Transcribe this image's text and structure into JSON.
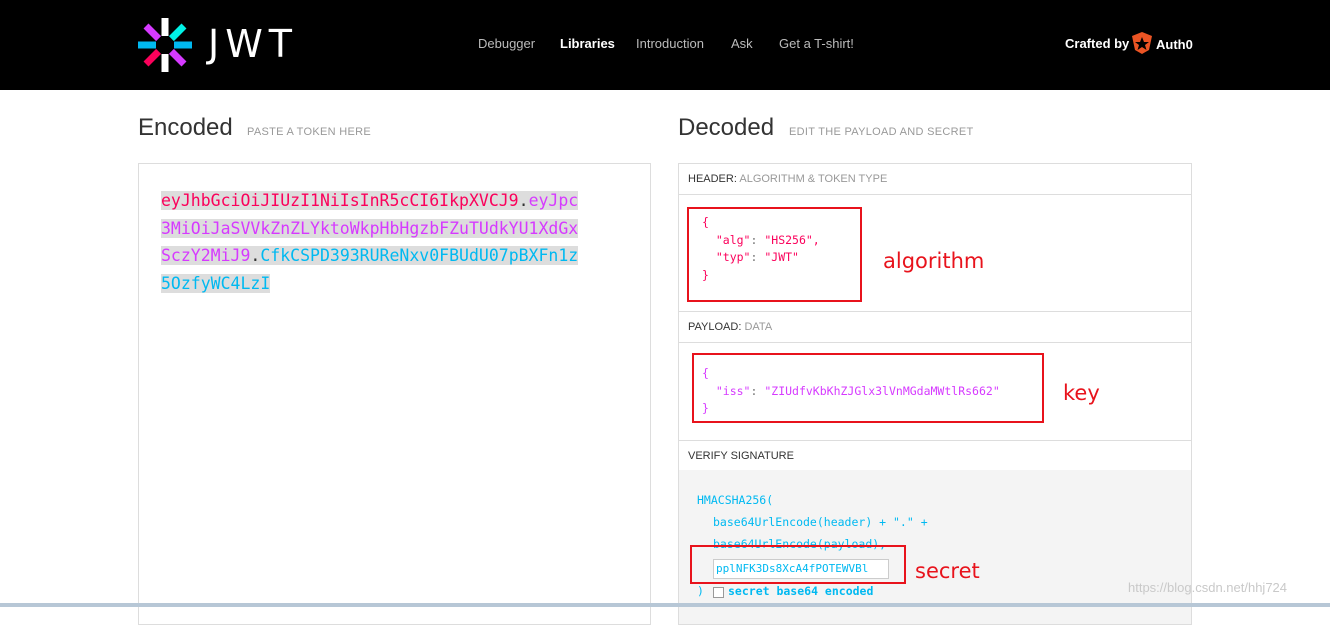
{
  "header": {
    "logo_text": "JWT",
    "nav": [
      "Debugger",
      "Libraries",
      "Introduction",
      "Ask",
      "Get a T-shirt!"
    ],
    "active_nav": "Libraries",
    "crafted_by": "Crafted by",
    "brand": "Auth0"
  },
  "encoded": {
    "title": "Encoded",
    "subtitle": "PASTE A TOKEN HERE",
    "token_header": "eyJhbGciOiJIUzI1NiIsInR5cCI6IkpXVCJ9",
    "token_payload": "eyJpc3MiOiJaSVVkZnZLYktoWkpHbHgzbFZuTUdkYU1XdGxSczY2MiJ9",
    "token_signature": "CfkCSPD393RUReNxv0FBUdU07pBXFn1z5OzfyWC4LzI",
    "dot": "."
  },
  "decoded": {
    "title": "Decoded",
    "subtitle": "EDIT THE PAYLOAD AND SECRET",
    "header_section": {
      "label": "HEADER:",
      "sub": "ALGORITHM & TOKEN TYPE"
    },
    "header_json": {
      "open": "{",
      "alg_key": "\"alg\"",
      "alg_val": "\"HS256\",",
      "typ_key": "\"typ\"",
      "typ_val": "\"JWT\"",
      "close": "}"
    },
    "payload_section": {
      "label": "PAYLOAD:",
      "sub": "DATA"
    },
    "payload_json": {
      "open": "{",
      "iss_key": "\"iss\"",
      "iss_val": "\"ZIUdfvKbKhZJGlx3lVnMGdaMWtlRs662\"",
      "close": "}"
    },
    "verify_section": {
      "label": "VERIFY SIGNATURE"
    },
    "verify": {
      "line1": "HMACSHA256(",
      "line2": "base64UrlEncode(header) + \".\" +",
      "line3": "base64UrlEncode(payload),",
      "secret_value": "pplNFK3Ds8XcA4fPOTEWVBl",
      "line_close": ")",
      "checkbox_label": "secret base64 encoded"
    }
  },
  "annotations": {
    "algorithm": "algorithm",
    "key": "key",
    "secret": "secret"
  },
  "watermark": "https://blog.csdn.net/hhj724",
  "colors": {
    "header_part": "#fb015b",
    "payload_part": "#d63aff",
    "signature_part": "#00b9f1",
    "annotation": "#e8131c"
  }
}
